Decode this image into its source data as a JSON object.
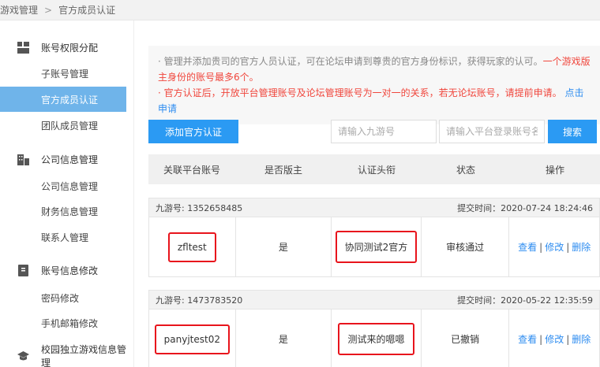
{
  "breadcrumb": {
    "root": "游戏管理",
    "separator": ">",
    "current": "官方成员认证"
  },
  "sidebar": {
    "groups": [
      {
        "label": "账号权限分配",
        "icon": "grid-icon",
        "items": [
          "子账号管理",
          "官方成员认证",
          "团队成员管理"
        ]
      },
      {
        "label": "公司信息管理",
        "icon": "building-icon",
        "items": [
          "公司信息管理",
          "财务信息管理",
          "联系人管理"
        ]
      },
      {
        "label": "账号信息修改",
        "icon": "id-card-icon",
        "items": [
          "密码修改",
          "手机邮箱修改"
        ]
      },
      {
        "label": "校园独立游戏信息管理",
        "icon": "graduation-cap-icon",
        "items": []
      }
    ],
    "active_item": "官方成员认证"
  },
  "notice": {
    "line1_gray": "· 管理并添加贵司的官方人员认证，可在论坛申请到尊贵的官方身份标识，获得玩家的认可。",
    "line1_red": "一个游戏版主身份的账号最多6个。",
    "line2_red": "· 官方认证后，开放平台管理账号及论坛管理账号为一对一的关系，若无论坛账号，请提前申请。",
    "line2_link": "点击申请"
  },
  "toolbar": {
    "add_label": "添加官方认证",
    "jiuyou_placeholder": "请输入九游号",
    "account_placeholder": "请输入平台登录账号名",
    "search_label": "搜索"
  },
  "table": {
    "headers": [
      "关联平台账号",
      "是否版主",
      "认证头衔",
      "状态",
      "操作"
    ],
    "records": [
      {
        "jiuyou": "九游号: 1352658485",
        "submit_time": "提交时间：2020-07-24 18:24:46",
        "account": "zfltest",
        "moderator": "是",
        "title": "协同测试2官方",
        "status": "审核通过",
        "actions": [
          "查看",
          "修改",
          "删除"
        ]
      },
      {
        "jiuyou": "九游号: 1473783520",
        "submit_time": "提交时间：2020-05-22 12:35:59",
        "account": "panyjtest02",
        "moderator": "是",
        "title": "测试来的嗯嗯",
        "status": "已撤销",
        "actions": [
          "查看",
          "修改",
          "删除"
        ]
      }
    ]
  },
  "colors": {
    "accent": "#2b9af3",
    "active_bg": "#6fb4ea",
    "warning": "#f0463c",
    "highlight": "#e8141c"
  }
}
